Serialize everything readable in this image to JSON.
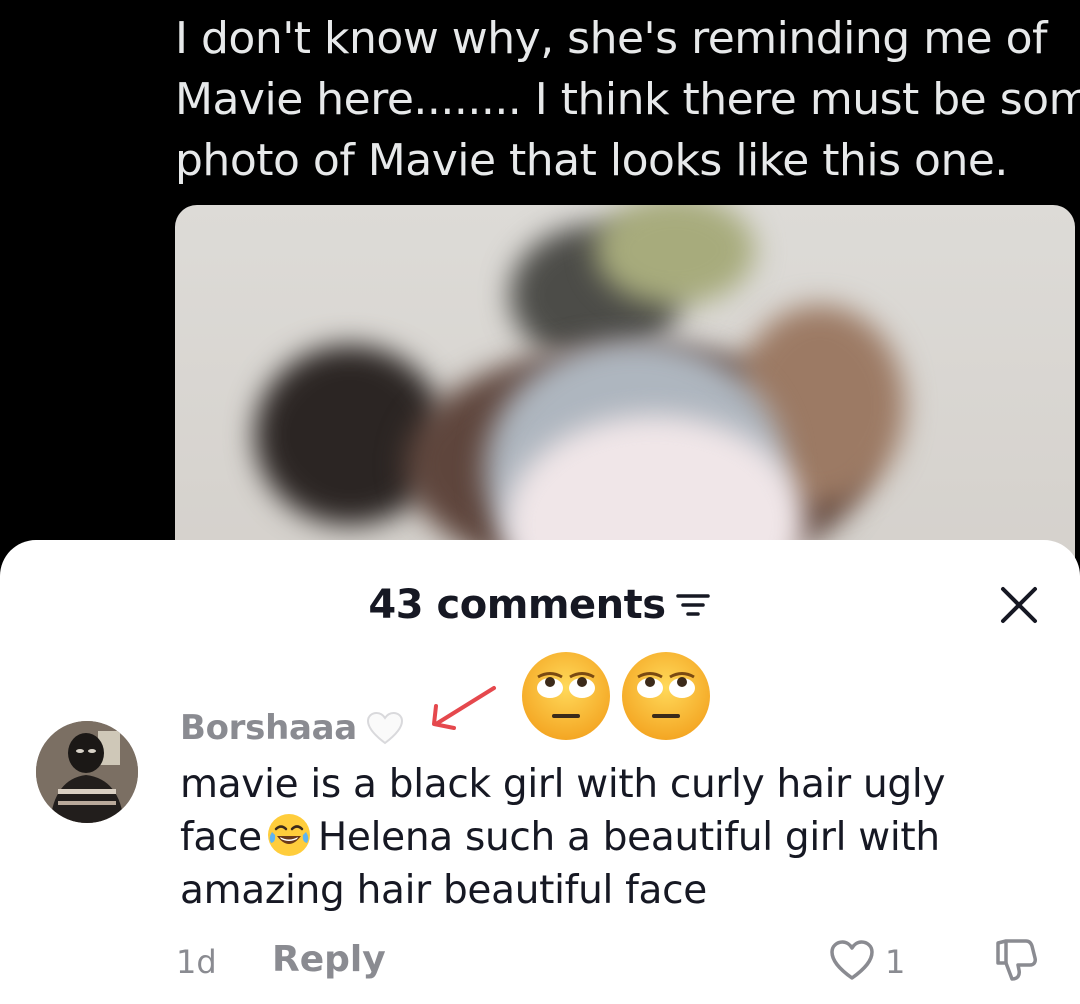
{
  "tweet": {
    "lines": [
      "I don't know why, she's reminding me of",
      "Mavie here........ I think there must be some",
      "photo of Mavie that looks like this one."
    ]
  },
  "sheet": {
    "comments_count": "43 comments",
    "filter_icon": "filter-lines-icon",
    "close_icon": "close-x-icon"
  },
  "annotation": {
    "arrow_color": "#e5484d",
    "emojis": [
      "face-with-rolling-eyes",
      "face-with-rolling-eyes"
    ]
  },
  "comment": {
    "username": "Borshaaa",
    "username_badge": "white-heart",
    "lines": [
      "mavie is a black girl with curly hair ugly",
      "face",
      "Helena such a beautiful girl with",
      "amazing hair beautiful face"
    ],
    "inline_emoji": "face-with-tears-of-joy",
    "time": "1d",
    "reply_label": "Reply",
    "like_count": "1"
  },
  "colors": {
    "sheet_bg": "#ffffff",
    "text_primary": "#161823",
    "text_secondary": "#8a8b91",
    "tweet_text": "#e7e9ea"
  }
}
